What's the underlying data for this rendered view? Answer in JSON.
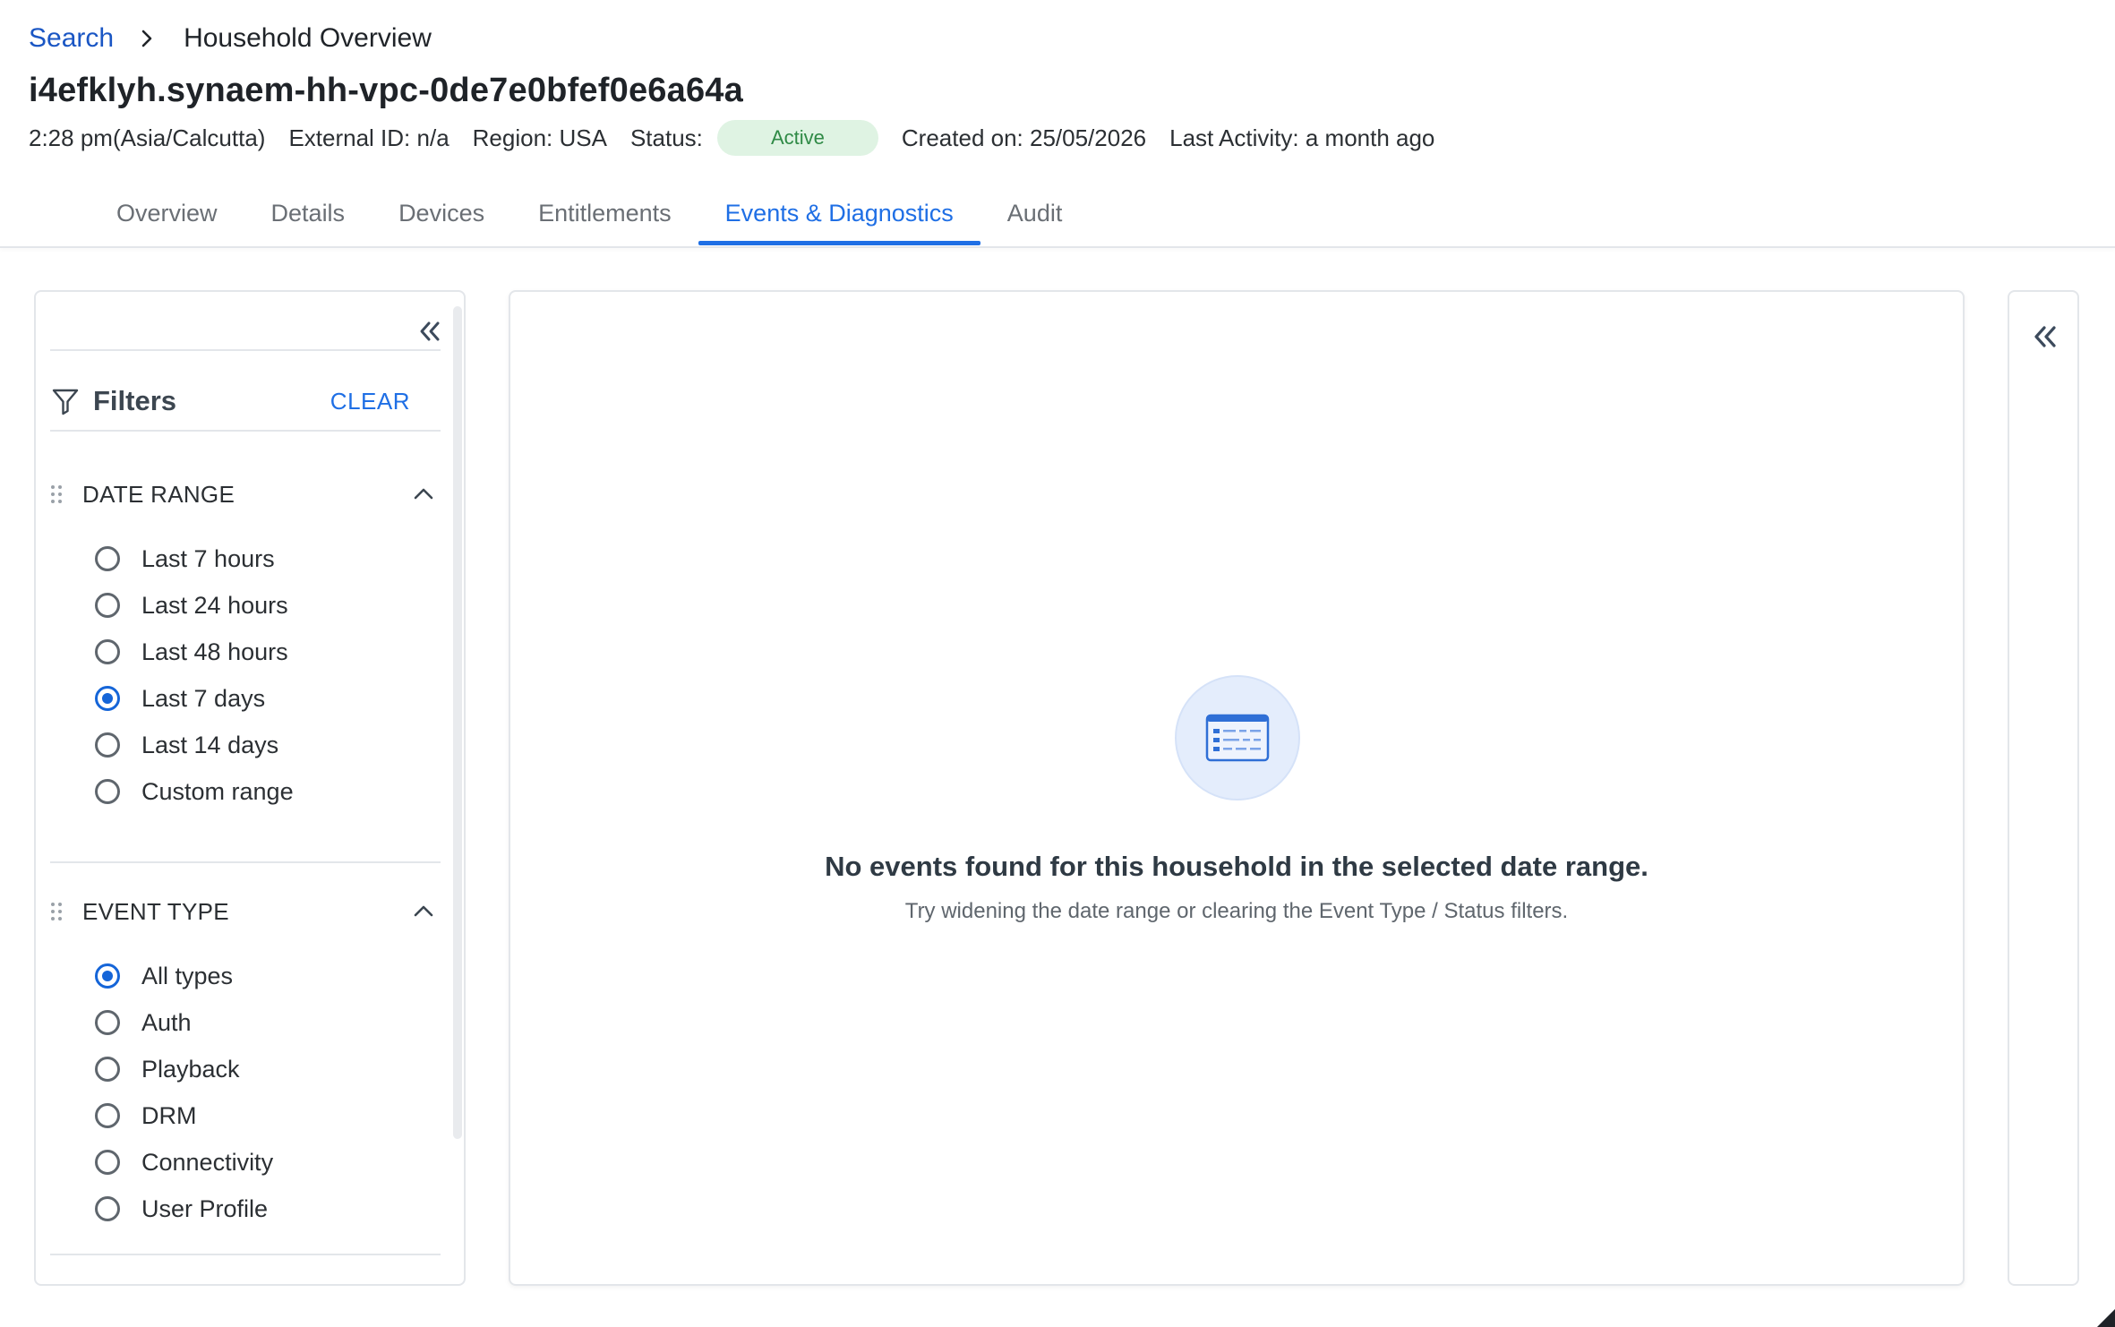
{
  "breadcrumb": {
    "link": "Search",
    "current": "Household Overview"
  },
  "household": {
    "id": "i4efklyh.synaem-hh-vpc-0de7e0bfef0e6a64a",
    "time": "2:28 pm(Asia/Calcutta)",
    "external_id": "External ID: n/a",
    "region": "Region: USA",
    "status_label": "Status:",
    "status_value": "Active",
    "created_on": "Created on: 25/05/2026",
    "last_activity": "Last Activity: a month ago"
  },
  "tabs": [
    {
      "label": "Overview",
      "active": false
    },
    {
      "label": "Details",
      "active": false
    },
    {
      "label": "Devices",
      "active": false
    },
    {
      "label": "Entitlements",
      "active": false
    },
    {
      "label": "Events & Diagnostics",
      "active": true
    },
    {
      "label": "Audit",
      "active": false
    }
  ],
  "filters": {
    "title": "Filters",
    "clear_label": "CLEAR",
    "date_range": {
      "title": "DATE RANGE",
      "options": [
        {
          "label": "Last 7 hours",
          "checked": false
        },
        {
          "label": "Last 24 hours",
          "checked": false
        },
        {
          "label": "Last 48 hours",
          "checked": false
        },
        {
          "label": "Last 7 days",
          "checked": true
        },
        {
          "label": "Last 14 days",
          "checked": false
        },
        {
          "label": "Custom range",
          "checked": false
        }
      ]
    },
    "event_type": {
      "title": "EVENT TYPE",
      "options": [
        {
          "label": "All types",
          "checked": true
        },
        {
          "label": "Auth",
          "checked": false
        },
        {
          "label": "Playback",
          "checked": false
        },
        {
          "label": "DRM",
          "checked": false
        },
        {
          "label": "Connectivity",
          "checked": false
        },
        {
          "label": "User Profile",
          "checked": false
        }
      ]
    }
  },
  "empty_state": {
    "title": "No events found for this household in the selected date range.",
    "subtitle": "Try widening the date range or clearing the Event Type / Status filters.",
    "icon": "event-list-icon"
  },
  "colors": {
    "accent": "#1f6fe5",
    "link": "#1a56c4",
    "status_bg": "#dff3e3",
    "status_text": "#2f8a46",
    "radio_checked": "#1565d8"
  }
}
